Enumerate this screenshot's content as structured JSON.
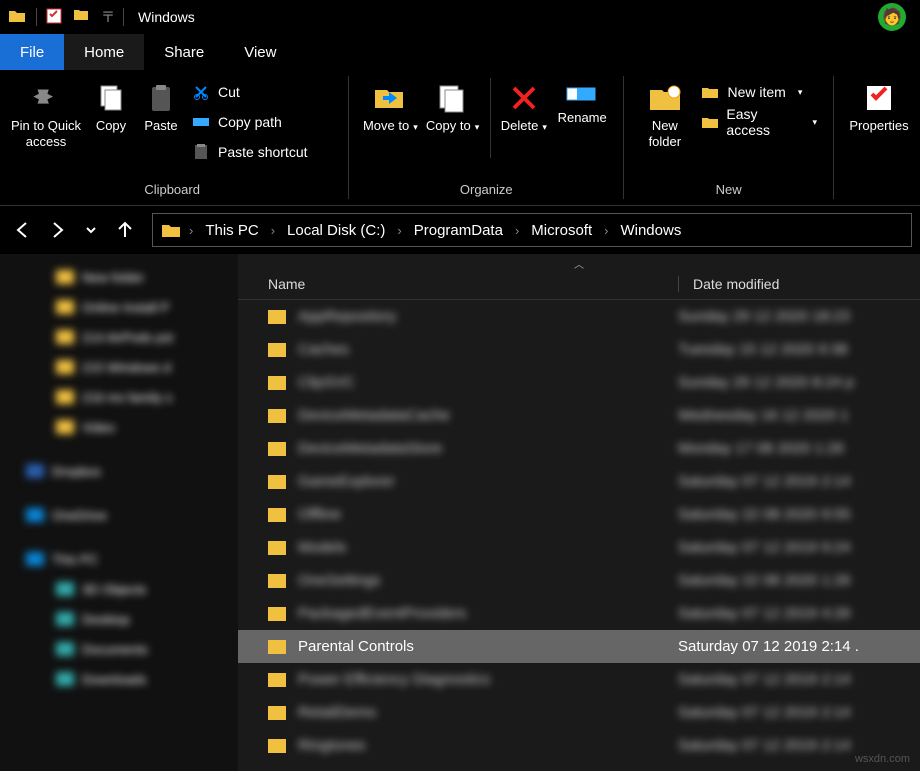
{
  "title": "Windows",
  "tabs": {
    "file": "File",
    "home": "Home",
    "share": "Share",
    "view": "View"
  },
  "ribbon": {
    "pin": "Pin to Quick access",
    "copy": "Copy",
    "paste": "Paste",
    "cut": "Cut",
    "copy_path": "Copy path",
    "paste_shortcut": "Paste shortcut",
    "clipboard": "Clipboard",
    "move_to": "Move to",
    "copy_to": "Copy to",
    "delete": "Delete",
    "rename": "Rename",
    "organize": "Organize",
    "new_folder": "New folder",
    "new_item": "New item",
    "easy_access": "Easy access",
    "new": "New",
    "properties": "Properties"
  },
  "breadcrumb": [
    "This PC",
    "Local Disk (C:)",
    "ProgramData",
    "Microsoft",
    "Windows"
  ],
  "columns": {
    "name": "Name",
    "date": "Date modified"
  },
  "selected": {
    "name": "Parental Controls",
    "date": "Saturday 07 12 2019 2:14 ."
  },
  "blurred_rows": [
    {
      "name": "AppRepository",
      "date": "Sunday 29 12 2020 18:23"
    },
    {
      "name": "Caches",
      "date": "Tuesday 15 12 2020 9:38"
    },
    {
      "name": "ClipSVC",
      "date": "Sunday 29 12 2020 8:24 p"
    },
    {
      "name": "DeviceMetadataCache",
      "date": "Wednesday 16 12 2020 1"
    },
    {
      "name": "DeviceMetadataStore",
      "date": "Monday 17 08 2020 1:26"
    },
    {
      "name": "GameExplorer",
      "date": "Saturday 07 12 2019 2:14"
    },
    {
      "name": "Offline",
      "date": "Saturday 22 08 2020 9:55"
    },
    {
      "name": "Models",
      "date": "Saturday 07 12 2019 9:24"
    },
    {
      "name": "OneSettings",
      "date": "Saturday 22 08 2020 1:26"
    },
    {
      "name": "PackagedEventProviders",
      "date": "Saturday 07 12 2019 4:26"
    }
  ],
  "blurred_rows_after": [
    {
      "name": "Power Efficiency Diagnostics",
      "date": "Saturday 07 12 2019 2:14"
    },
    {
      "name": "RetailDemo",
      "date": "Saturday 07 12 2019 2:14"
    },
    {
      "name": "Ringtones",
      "date": "Saturday 07 12 2019 2:14"
    }
  ],
  "watermark": "wsxdn.com"
}
